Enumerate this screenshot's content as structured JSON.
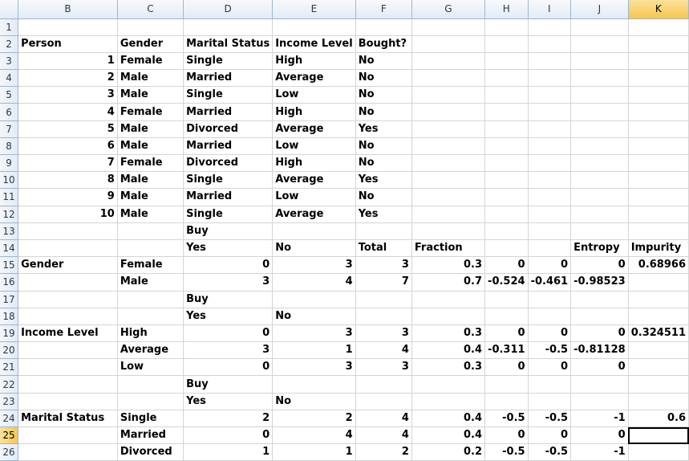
{
  "columns": [
    "B",
    "C",
    "D",
    "E",
    "F",
    "G",
    "H",
    "I",
    "J",
    "K"
  ],
  "selected_column": "K",
  "selected_row": 25,
  "active_cell": "K25",
  "rows": [
    {
      "r": 1,
      "cells": [
        "",
        "",
        "",
        "",
        "",
        "",
        "",
        "",
        "",
        ""
      ]
    },
    {
      "r": 2,
      "cells": [
        "Person",
        "Gender",
        "Marital Status",
        "Income Level",
        "Bought?",
        "",
        "",
        "",
        "",
        ""
      ]
    },
    {
      "r": 3,
      "cells": [
        "1",
        "Female",
        "Single",
        "High",
        "No",
        "",
        "",
        "",
        "",
        ""
      ]
    },
    {
      "r": 4,
      "cells": [
        "2",
        "Male",
        "Married",
        "Average",
        "No",
        "",
        "",
        "",
        "",
        ""
      ]
    },
    {
      "r": 5,
      "cells": [
        "3",
        "Male",
        "Single",
        "Low",
        "No",
        "",
        "",
        "",
        "",
        ""
      ]
    },
    {
      "r": 6,
      "cells": [
        "4",
        "Female",
        "Married",
        "High",
        "No",
        "",
        "",
        "",
        "",
        ""
      ]
    },
    {
      "r": 7,
      "cells": [
        "5",
        "Male",
        "Divorced",
        "Average",
        "Yes",
        "",
        "",
        "",
        "",
        ""
      ]
    },
    {
      "r": 8,
      "cells": [
        "6",
        "Male",
        "Married",
        "Low",
        "No",
        "",
        "",
        "",
        "",
        ""
      ]
    },
    {
      "r": 9,
      "cells": [
        "7",
        "Female",
        "Divorced",
        "High",
        "No",
        "",
        "",
        "",
        "",
        ""
      ]
    },
    {
      "r": 10,
      "cells": [
        "8",
        "Male",
        "Single",
        "Average",
        "Yes",
        "",
        "",
        "",
        "",
        ""
      ]
    },
    {
      "r": 11,
      "cells": [
        "9",
        "Male",
        "Married",
        "Low",
        "No",
        "",
        "",
        "",
        "",
        ""
      ]
    },
    {
      "r": 12,
      "cells": [
        "10",
        "Male",
        "Single",
        "Average",
        "Yes",
        "",
        "",
        "",
        "",
        ""
      ]
    },
    {
      "r": 13,
      "cells": [
        "",
        "",
        "Buy",
        "",
        "",
        "",
        "",
        "",
        "",
        ""
      ]
    },
    {
      "r": 14,
      "cells": [
        "",
        "",
        "Yes",
        "No",
        "Total",
        "Fraction",
        "",
        "",
        "Entropy",
        "Impurity"
      ]
    },
    {
      "r": 15,
      "cells": [
        "Gender",
        "Female",
        "0",
        "3",
        "3",
        "0.3",
        "0",
        "0",
        "0",
        "0.68966"
      ]
    },
    {
      "r": 16,
      "cells": [
        "",
        "Male",
        "3",
        "4",
        "7",
        "0.7",
        "-0.524",
        "-0.461",
        "-0.98523",
        ""
      ]
    },
    {
      "r": 17,
      "cells": [
        "",
        "",
        "Buy",
        "",
        "",
        "",
        "",
        "",
        "",
        ""
      ]
    },
    {
      "r": 18,
      "cells": [
        "",
        "",
        "Yes",
        "No",
        "",
        "",
        "",
        "",
        "",
        ""
      ]
    },
    {
      "r": 19,
      "cells": [
        "Income Level",
        "High",
        "0",
        "3",
        "3",
        "0.3",
        "0",
        "0",
        "0",
        "0.324511"
      ]
    },
    {
      "r": 20,
      "cells": [
        "",
        "Average",
        "3",
        "1",
        "4",
        "0.4",
        "-0.311",
        "-0.5",
        "-0.81128",
        ""
      ]
    },
    {
      "r": 21,
      "cells": [
        "",
        "Low",
        "0",
        "3",
        "3",
        "0.3",
        "0",
        "0",
        "0",
        ""
      ]
    },
    {
      "r": 22,
      "cells": [
        "",
        "",
        "Buy",
        "",
        "",
        "",
        "",
        "",
        "",
        ""
      ]
    },
    {
      "r": 23,
      "cells": [
        "",
        "",
        "Yes",
        "No",
        "",
        "",
        "",
        "",
        "",
        ""
      ]
    },
    {
      "r": 24,
      "cells": [
        "Marital Status",
        "Single",
        "2",
        "2",
        "4",
        "0.4",
        "-0.5",
        "-0.5",
        "-1",
        "0.6"
      ]
    },
    {
      "r": 25,
      "cells": [
        "",
        "Married",
        "0",
        "4",
        "4",
        "0.4",
        "0",
        "0",
        "0",
        ""
      ]
    },
    {
      "r": 26,
      "cells": [
        "",
        "Divorced",
        "1",
        "1",
        "2",
        "0.2",
        "-0.5",
        "-0.5",
        "-1",
        ""
      ]
    }
  ]
}
